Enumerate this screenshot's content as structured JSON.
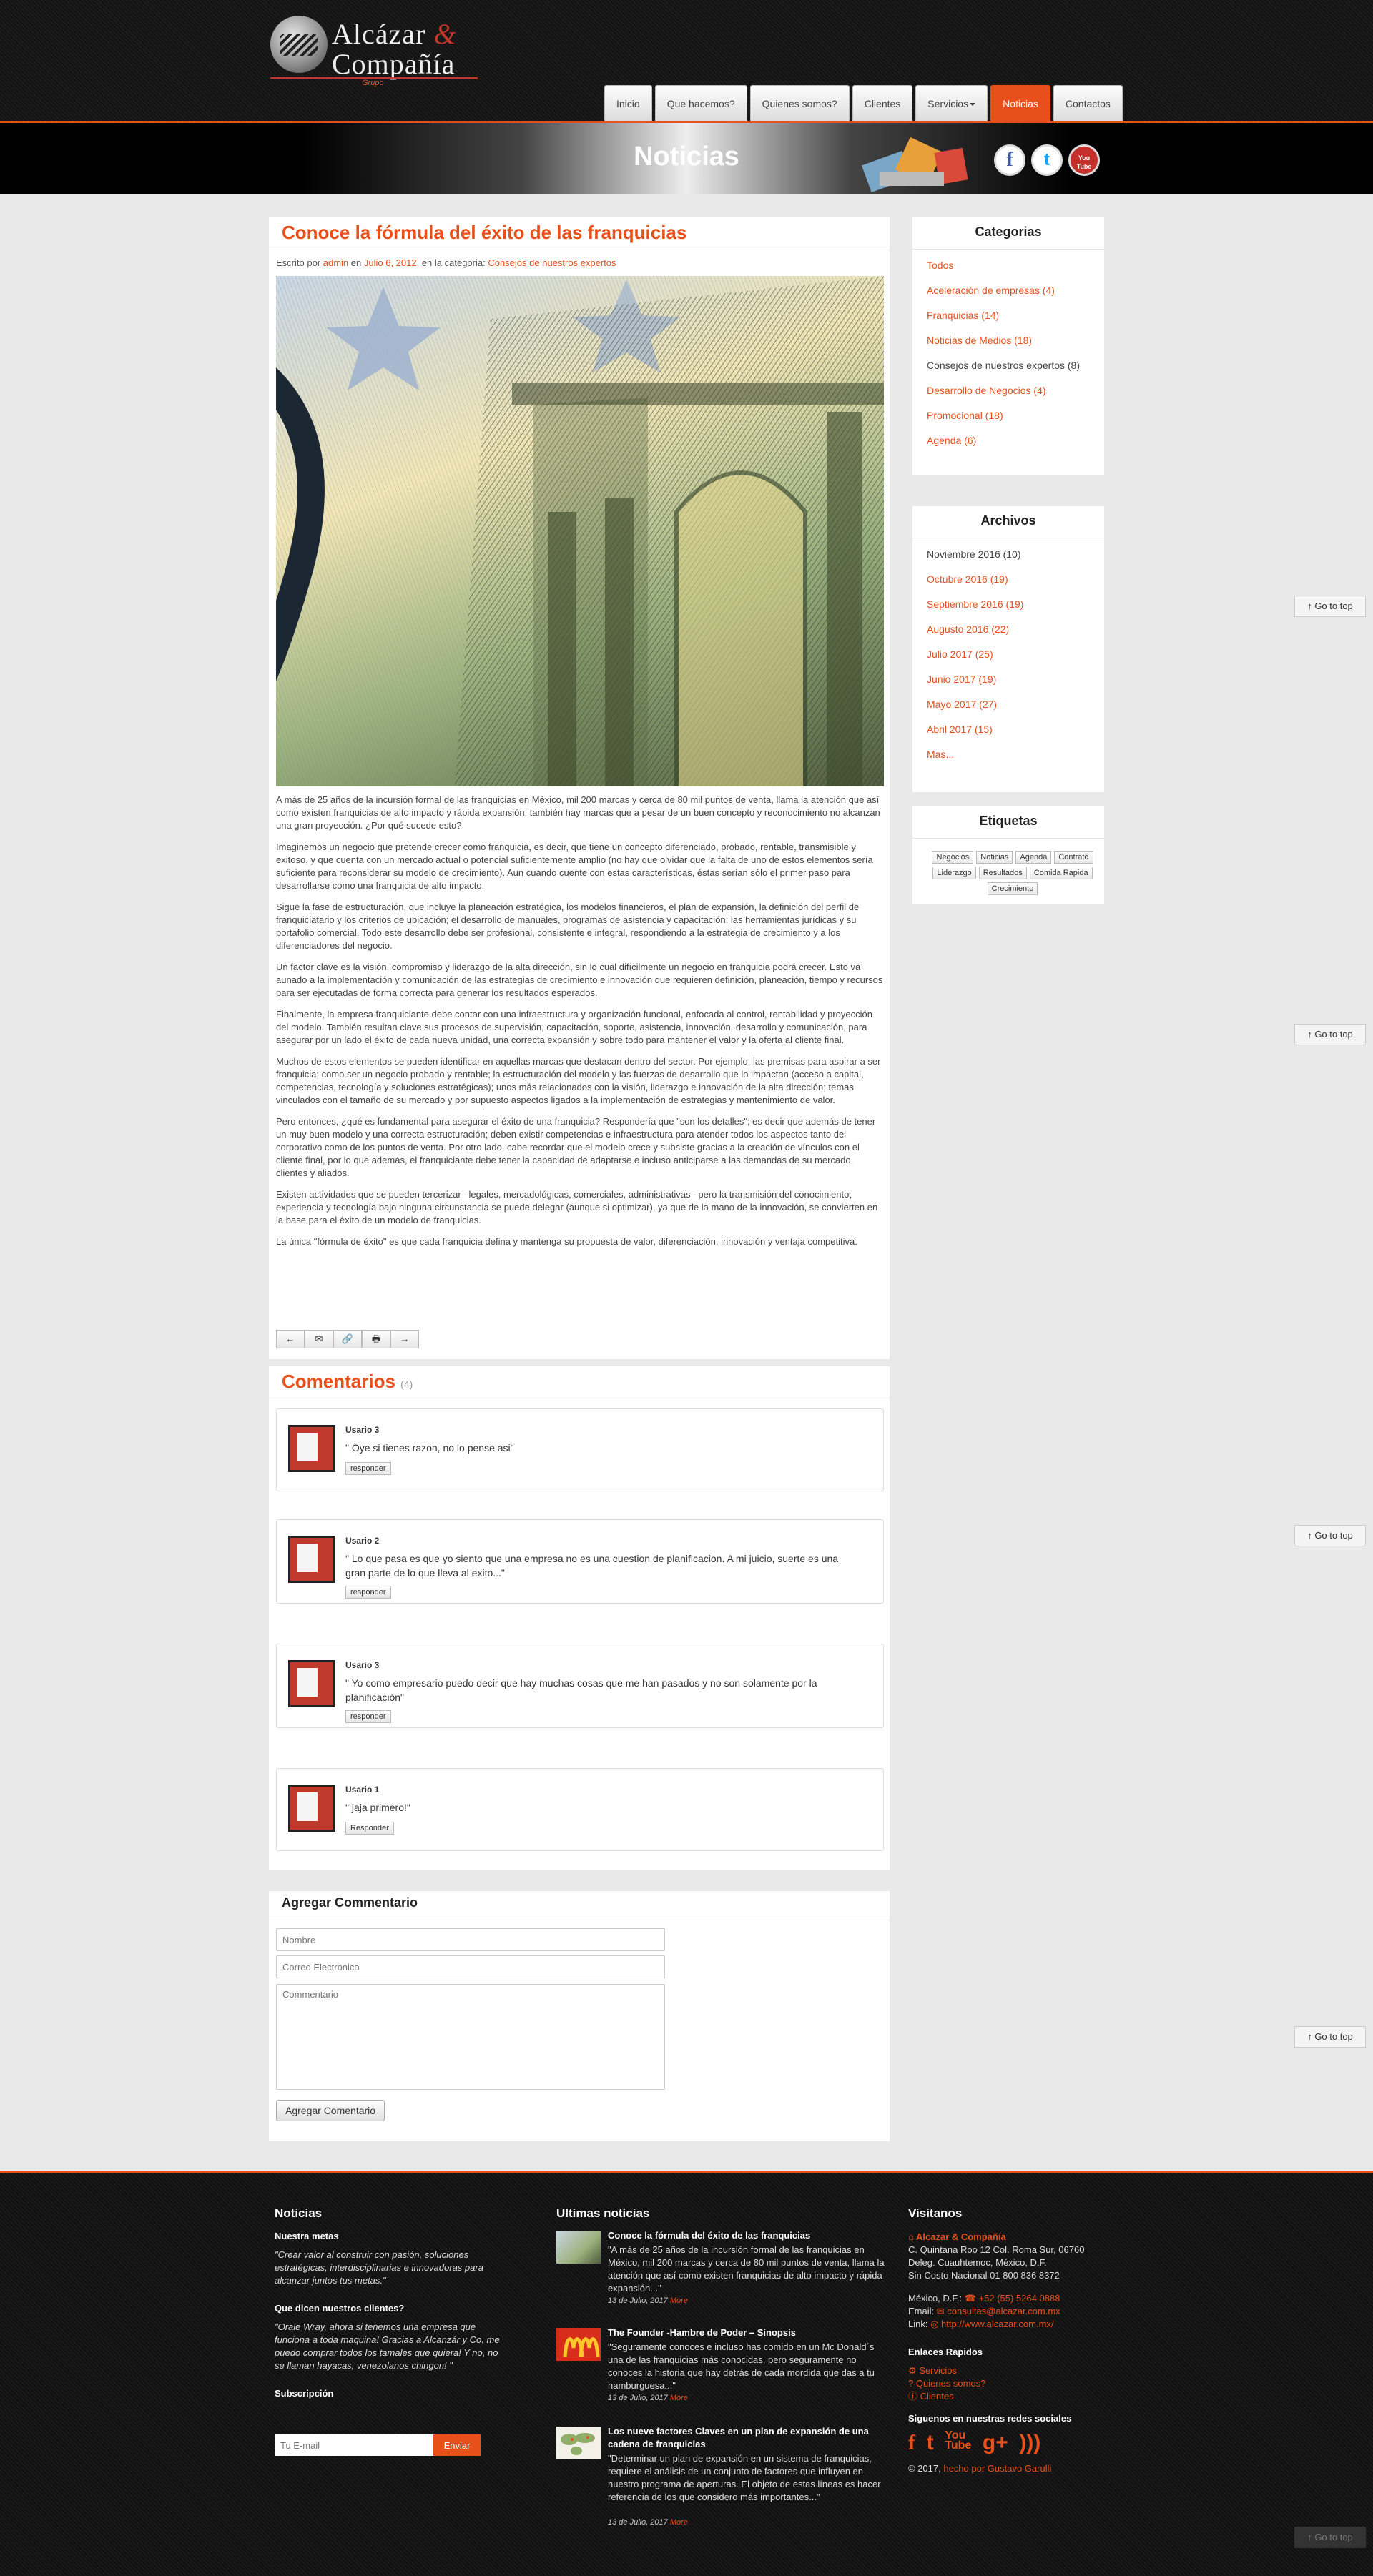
{
  "brand": {
    "line1_a": "Alcázar ",
    "line1_amp": "&",
    "line2": "Compañía",
    "tagline": "Grupo"
  },
  "nav": [
    {
      "label": "Inicio"
    },
    {
      "label": "Que hacemos?"
    },
    {
      "label": "Quienes somos?"
    },
    {
      "label": "Clientes"
    },
    {
      "label": "Servicios"
    },
    {
      "label": "Noticias"
    },
    {
      "label": "Contactos"
    }
  ],
  "banner": {
    "title": "Noticias",
    "social": [
      "f",
      "t",
      "You Tube"
    ]
  },
  "article": {
    "title": "Conoce la fórmula del éxito de las franquicias",
    "meta_prefix": "Escrito por ",
    "author": "admin",
    "meta_mid": " en ",
    "date": "Julio 6, 2012",
    "meta_cat": ", en la categoria: ",
    "category": "Consejos de nuestros expertos",
    "paragraphs": [
      "A más de 25 años de la incursión formal de las franquicias en México, mil 200 marcas y cerca de 80 mil puntos de venta, llama la atención que así como existen franquicias de alto impacto y rápida expansión, también hay marcas que a pesar de un buen concepto y reconocimiento no alcanzan una gran proyección. ¿Por qué sucede esto?",
      "Imaginemos un negocio que pretende crecer como franquicia, es decir, que tiene un concepto diferenciado, probado, rentable, transmisible y exitoso, y que cuenta con un mercado actual o potencial suficientemente amplio (no hay que olvidar que la falta de uno de estos elementos sería suficiente para reconsiderar su modelo de crecimiento). Aun cuando cuente con estas características, éstas serían sólo el primer paso para desarrollarse como una franquicia de alto impacto.",
      "Sigue la fase de estructuración, que incluye la planeación estratégica, los modelos financieros, el plan de expansión, la definición del perfil de franquiciatario y los criterios de ubicación; el desarrollo de manuales, programas de asistencia y capacitación; las herramientas jurídicas y su portafolio comercial. Todo este desarrollo debe ser profesional, consistente e integral, respondiendo a la estrategia de crecimiento y a los diferenciadores del negocio.",
      "Un factor clave es la visión, compromiso y liderazgo de la alta dirección, sin lo cual difícilmente un negocio en franquicia podrá crecer. Esto va aunado a la implementación y comunicación de las estrategias de crecimiento e innovación que requieren definición, planeación, tiempo y recursos para ser ejecutadas de forma correcta para generar los resultados esperados.",
      "Finalmente, la empresa franquiciante debe contar con una infraestructura y organización funcional, enfocada al control, rentabilidad y proyección del modelo. También resultan clave sus procesos de supervisión, capacitación, soporte, asistencia, innovación, desarrollo y comunicación, para asegurar por un lado el éxito de cada nueva unidad, una correcta expansión y sobre todo para mantener el valor y la oferta al cliente final.",
      "Muchos de estos elementos se pueden identificar en aquellas marcas que destacan dentro del sector. Por ejemplo, las premisas para aspirar a ser franquicia; como ser un negocio probado y rentable; la estructuración del modelo y las fuerzas de desarrollo que lo impactan (acceso a capital, competencias, tecnología y soluciones estratégicas); unos más relacionados con la visión, liderazgo e innovación de la alta dirección; temas vinculados con el tamaño de su mercado y por supuesto aspectos ligados a la implementación de estrategias y mantenimiento de valor.",
      "Pero entonces, ¿qué es fundamental para asegurar el éxito de una franquicia? Respondería que \"son los detalles\"; es decir que además de tener un muy buen modelo y una correcta estructuración; deben existir competencias e infraestructura para atender todos los aspectos tanto del corporativo como de los puntos de venta. Por otro lado, cabe recordar que el modelo crece y subsiste gracias a la creación de vínculos con el cliente final, por lo que además, el franquiciante debe tener la capacidad de adaptarse e incluso anticiparse a las demandas de su mercado, clientes y aliados.",
      "Existen actividades que se pueden tercerizar –legales, mercadológicas, comerciales, administrativas– pero la transmisión del conocimiento, experiencia y tecnología bajo ninguna circunstancia se puede delegar (aunque si optimizar), ya que de la mano de la innovación, se convierten en la base para el éxito de un modelo de franquicias.",
      "La única \"fórmula de éxito\" es que cada franquicia defina y mantenga su propuesta de valor, diferenciación, innovación y ventaja competitiva."
    ],
    "toolbar": [
      "←",
      "✉",
      "🔗",
      "🖶",
      "→"
    ]
  },
  "comments": {
    "title": "Comentarios",
    "count": "(4)",
    "items": [
      {
        "user": "Usario 3",
        "text": "\" Oye si tienes razon, no lo pense asi\"",
        "reply": "responder"
      },
      {
        "user": "Usario 2",
        "text": "\" Lo que pasa es que yo siento que una empresa no es una cuestion de planificacion. A mi juicio, suerte es una gran parte de lo que lleva al exito...\"",
        "reply": "responder"
      },
      {
        "user": "Usario 3",
        "text": "\" Yo como empresario puedo decir que hay muchas cosas que me han pasados y no son solamente por la planificación\"",
        "reply": "responder"
      },
      {
        "user": "Usario 1",
        "text": "\" jaja primero!\"",
        "reply": "Responder"
      }
    ]
  },
  "add_comment": {
    "title": "Agregar Commentario",
    "name_placeholder": "Nombre",
    "email_placeholder": "Correo Electronico",
    "comment_placeholder": "Commentario",
    "submit": "Agregar Comentario"
  },
  "sidebar": {
    "categories": {
      "title": "Categorias",
      "items": [
        {
          "label": "Todos",
          "active": true
        },
        {
          "label": "Aceleración de empresas (4)",
          "active": true
        },
        {
          "label": "Franquicias (14)",
          "active": true
        },
        {
          "label": "Noticias de Medios (18)",
          "active": true
        },
        {
          "label": "Consejos de nuestros expertos (8)",
          "active": false
        },
        {
          "label": "Desarrollo de Negocios (4)",
          "active": true
        },
        {
          "label": "Promocional (18)",
          "active": true
        },
        {
          "label": "Agenda (6)",
          "active": true
        }
      ]
    },
    "archives": {
      "title": "Archivos",
      "items": [
        {
          "label": "Noviembre 2016 (10)",
          "active": false
        },
        {
          "label": "Octubre 2016 (19)",
          "active": true
        },
        {
          "label": "Septiembre 2016 (19)",
          "active": true
        },
        {
          "label": "Augusto 2016 (22)",
          "active": true
        },
        {
          "label": "Julio 2017 (25)",
          "active": true
        },
        {
          "label": "Junio 2017 (19)",
          "active": true
        },
        {
          "label": "Mayo 2017 (27)",
          "active": true
        },
        {
          "label": "Abril 2017 (15)",
          "active": true
        },
        {
          "label": "Mas...",
          "active": true
        }
      ]
    },
    "tags": {
      "title": "Etiquetas",
      "items": [
        "Negocios",
        "Noticias",
        "Agenda",
        "Contrato",
        "Liderazgo",
        "Resultados",
        "Comida Rapida",
        "Crecimiento"
      ]
    }
  },
  "go_top": "Go to top",
  "footer": {
    "col1": {
      "title": "Noticias",
      "metas_title": "Nuestra metas",
      "metas_text": "\"Crear valor al construir con pasión, soluciones estratégicas, interdisciplinarias e innovadoras para alcanzar juntos tus metas.\"",
      "clients_title": "Que dicen nuestros clientes?",
      "clients_text": "\"Orale Wray, ahora si tenemos una empresa que funciona a toda maquina! Gracias a Alcanzár y Co. me puedo comprar todos los tamales que quiera! Y no, no se llaman hayacas, venezolanos chingon! \"",
      "subscribe_title": "Subscripción",
      "email_placeholder": "Tu E-mail",
      "send": "Enviar"
    },
    "col2": {
      "title": "Ultimas noticias",
      "items": [
        {
          "title": "Conoce la fórmula del éxito de las franquicias",
          "text": "\"A más de 25 años de la incursión formal de las franquicias en México, mil 200 marcas y cerca de 80 mil puntos de venta, llama la atención que así como existen franquicias de alto impacto y rápida expansión...\"",
          "date": "13 de Julio, 2017",
          "more": "More"
        },
        {
          "title": "The Founder -Hambre de Poder – Sinopsis",
          "text": "\"Seguramente conoces e incluso has comido en un Mc Donald´s una de las franquicias más conocidas, pero seguramente no conoces la historia que hay detrás de cada mordida que das a tu hamburguesa...\"",
          "date": "13 de Julio, 2017",
          "more": "More"
        },
        {
          "title": "Los nueve factores Claves en un plan de expansión de una cadena de franquicias",
          "text": "\"Determinar un plan de expansión en un sistema de franquicias, requiere el análisis de un conjunto de factores que influyen en nuestro programa de aperturas. El objeto de estas líneas es hacer referencia de los que considero más importantes...\"",
          "date": "13 de Julio, 2017",
          "more": "More"
        }
      ]
    },
    "col3": {
      "title": "Visitanos",
      "company": "Alcazar & Compañía",
      "address1": "C. Quintana Roo 12 Col. Roma Sur, 06760",
      "address2": "Deleg. Cuauhtemoc, México, D.F.",
      "address3": "Sin Costo Nacional 01 800 836 8372",
      "phone_label": "México, D.F.: ",
      "phone": "+52 (55) 5264 0888",
      "email_label": "Email: ",
      "email": "consultas@alcazar.com.mx",
      "link_label": "Link: ",
      "link": "http://www.alcazar.com.mx/",
      "links_title": "Enlaces Rapidos",
      "links": [
        "Servicios",
        "Quienes somos?",
        "Clientes"
      ],
      "social_title": "Siguenos en nuestras redes sociales",
      "copyright_prefix": "© 2017, ",
      "copyright_link": "hecho por Gustavo Garulli"
    }
  }
}
